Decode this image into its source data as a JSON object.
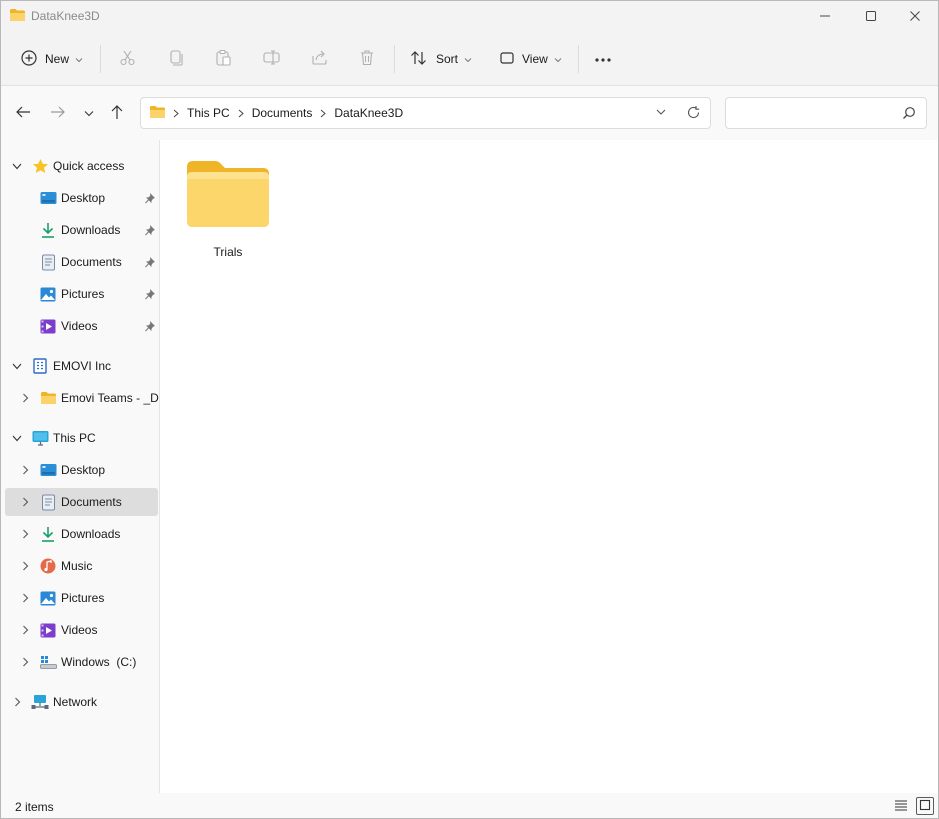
{
  "window": {
    "title": "DataKnee3D"
  },
  "toolbar": {
    "new_label": "New",
    "sort_label": "Sort",
    "view_label": "View",
    "more_label": "•••"
  },
  "address": {
    "crumbs": [
      "This PC",
      "Documents",
      "DataKnee3D"
    ],
    "search_placeholder": ""
  },
  "sidebar": {
    "quick_access": {
      "label": "Quick access",
      "items": [
        "Desktop",
        "Downloads",
        "Documents",
        "Pictures",
        "Videos"
      ]
    },
    "org": {
      "label": "EMOVI Inc",
      "items": [
        "Emovi Teams - _De"
      ]
    },
    "this_pc": {
      "label": "This PC",
      "items": [
        "Desktop",
        "Documents",
        "Downloads",
        "Music",
        "Pictures",
        "Videos",
        "Windows  (C:)"
      ],
      "selected": "Documents"
    },
    "network": {
      "label": "Network"
    }
  },
  "content": {
    "items": [
      {
        "name": "Trials",
        "type": "folder"
      }
    ]
  },
  "status": {
    "item_count": "2 items"
  },
  "colors": {
    "folder": "#f5c84c",
    "selected_bg": "#dddddd",
    "accent": "#0067c0"
  }
}
